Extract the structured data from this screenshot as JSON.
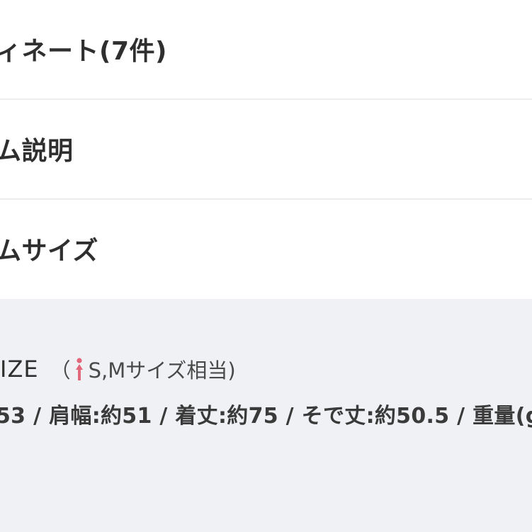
{
  "accordion": {
    "items": [
      {
        "label": "ィネート(7件)"
      },
      {
        "label": "ム説明"
      },
      {
        "label": "ムサイズ"
      }
    ]
  },
  "size_panel": {
    "title": "IZE",
    "note_open": "（",
    "note_text": "S,Mサイズ相当)",
    "measurements": "53 / 肩幅:約51 / 着丈:約75 / そで丈:約50.5 / 重量(g"
  },
  "colors": {
    "person_icon": "#e2677a",
    "panel_bg": "#eff1f4",
    "divider": "#ececec"
  },
  "icons": {
    "person": "person-icon"
  }
}
